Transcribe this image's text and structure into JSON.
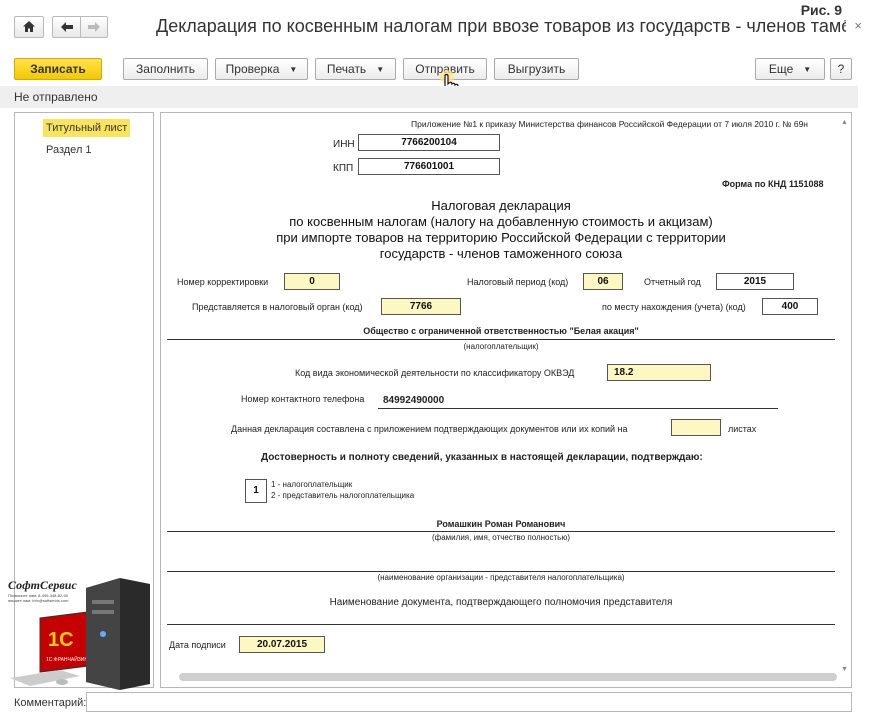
{
  "figure_label": "Рис. 9",
  "window": {
    "title": "Декларация по косвенным налогам при ввозе товаров из государств - членов таможе...",
    "home_icon": "home-icon",
    "back_icon": "arrow-left-icon",
    "forward_icon": "arrow-right-icon",
    "more_icon": "more-icon",
    "close_glyph": "×"
  },
  "toolbar": {
    "save_label": "Записать",
    "fill_label": "Заполнить",
    "check_label": "Проверка",
    "print_label": "Печать",
    "send_label": "Отправить",
    "export_label": "Выгрузить",
    "more_label": "Еще",
    "help_label": "?"
  },
  "status": "Не отправлено",
  "sections": [
    {
      "label": "Титульный лист",
      "active": true
    },
    {
      "label": "Раздел 1",
      "active": false
    }
  ],
  "form": {
    "appendix_note": "Приложение №1 к приказу Министерства финансов Российской Федерации  от 7 июля 2010 г. № 69н",
    "inn_label": "ИНН",
    "inn_value": "7766200104",
    "kpp_label": "КПП",
    "kpp_value": "776601001",
    "form_code": "Форма по КНД 1151088",
    "title_lines": [
      "Налоговая декларация",
      "по косвенным налогам (налогу на добавленную стоимость и акцизам)",
      "при импорте товаров на территорию Российской Федерации с территории",
      "государств - членов таможенного союза"
    ],
    "correction_label": "Номер корректировки",
    "correction_value": "0",
    "period_label": "Налоговый период (код)",
    "period_value": "06",
    "year_label": "Отчетный год",
    "year_value": "2015",
    "tax_org_label": "Представляется в налоговый орган (код)",
    "tax_org_value": "7766",
    "location_label": "по месту нахождения (учета) (код)",
    "location_value": "400",
    "taxpayer_name": "Общество с ограниченной ответственностью \"Белая акация\"",
    "taxpayer_caption": "(налогоплательщик)",
    "okved_label": "Код вида экономической деятельности по классификатору ОКВЭД",
    "okved_value": "18.2",
    "phone_label": "Номер контактного телефона",
    "phone_value": "84992490000",
    "attachments_label": "Данная декларация составлена с приложением подтверждающих документов или их копий на",
    "attachments_value": "",
    "attachments_unit": "листах",
    "confirm_heading": "Достоверность и полноту сведений, указанных в настоящей декларации, подтверждаю:",
    "signer_type_value": "1",
    "signer_option_1": "1 - налогоплательщик",
    "signer_option_2": "2 - представитель налогоплательщика",
    "signer_name": "Ромашкин Роман Романович",
    "signer_caption": "(фамилия, имя, отчество полностью)",
    "rep_org_caption": "(наименование организации - представителя налогоплательщика)",
    "rep_doc_label": "Наименование документа, подтверждающего полномочия представителя",
    "sign_date_label": "Дата подписи",
    "sign_date_value": "20.07.2015"
  },
  "comment_label": "Комментарий:",
  "promo": {
    "brand": "СофтСервис",
    "line1": "Позвоните нам: 8-499-348-82-90",
    "line2": "пишите нам: info@softservis.com",
    "logo_text": "1С",
    "logo_sub": "1С:ФРАНЧАЙЗИНГ"
  },
  "colors": {
    "accent_yellow": "#f4c800",
    "field_yellow": "#fdf7c2",
    "active_item": "#fbe45d"
  }
}
